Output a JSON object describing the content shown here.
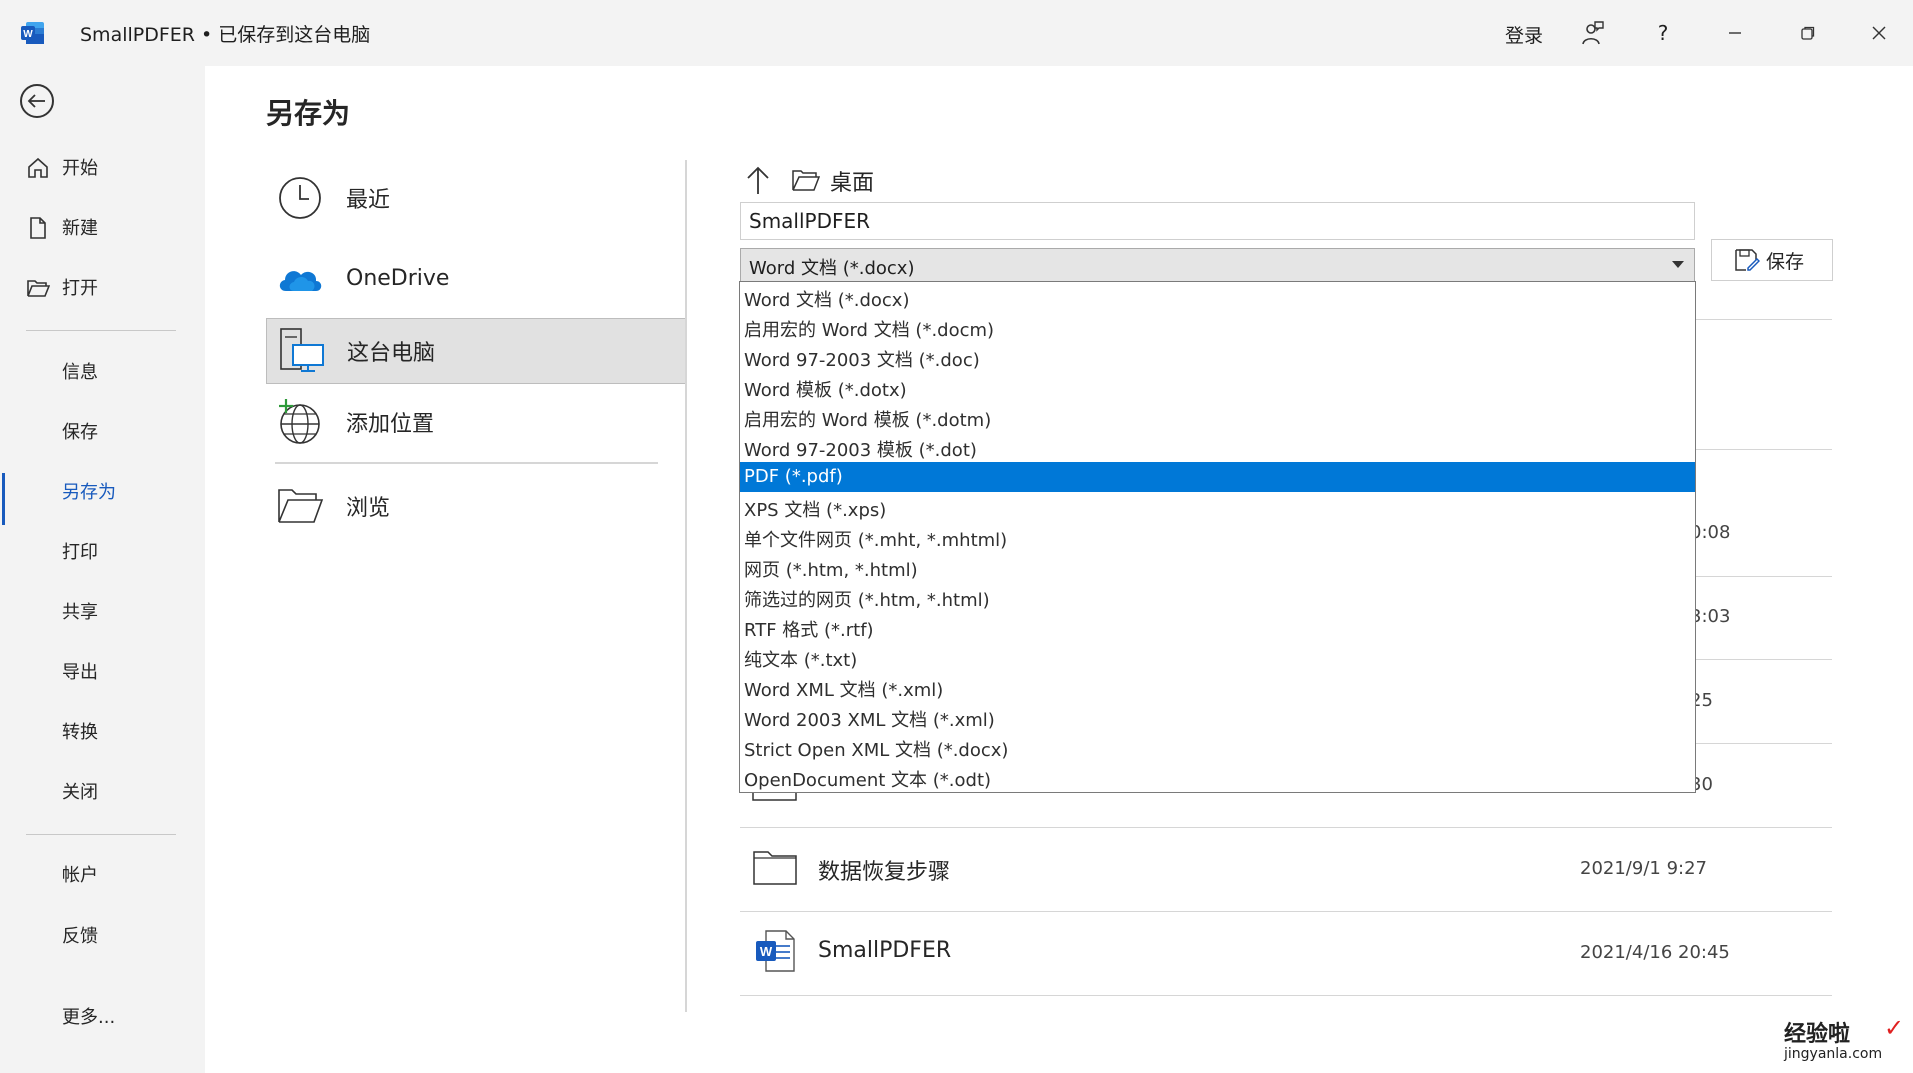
{
  "titlebar": {
    "title": "SmallPDFER • 已保存到这台电脑",
    "login": "登录",
    "help": "?"
  },
  "nav": {
    "items": [
      {
        "label": "开始",
        "icon": "home-icon"
      },
      {
        "label": "新建",
        "icon": "new-document-icon"
      },
      {
        "label": "打开",
        "icon": "open-folder-icon"
      },
      {
        "label": "信息"
      },
      {
        "label": "保存"
      },
      {
        "label": "另存为",
        "active": true
      },
      {
        "label": "打印"
      },
      {
        "label": "共享"
      },
      {
        "label": "导出"
      },
      {
        "label": "转换"
      },
      {
        "label": "关闭"
      },
      {
        "label": "帐户"
      },
      {
        "label": "反馈"
      },
      {
        "label": "更多..."
      }
    ]
  },
  "page": {
    "title": "另存为"
  },
  "locations": [
    {
      "label": "最近",
      "icon": "clock-icon"
    },
    {
      "label": "OneDrive",
      "icon": "onedrive-cloud-icon"
    },
    {
      "label": "这台电脑",
      "icon": "this-pc-icon",
      "selected": true
    },
    {
      "label": "添加位置",
      "icon": "add-location-globe-icon"
    },
    {
      "label": "浏览",
      "icon": "browse-folder-icon"
    }
  ],
  "save_panel": {
    "current_folder": "桌面",
    "filename_value": "SmallPDFER",
    "filetype_selected": "Word 文档 (*.docx)",
    "save_button": "保存"
  },
  "file_types": [
    "Word 文档 (*.docx)",
    "启用宏的 Word 文档 (*.docm)",
    "Word 97-2003 文档 (*.doc)",
    "Word 模板 (*.dotx)",
    "启用宏的 Word 模板 (*.dotm)",
    "Word 97-2003 模板 (*.dot)",
    "PDF (*.pdf)",
    "XPS 文档 (*.xps)",
    "单个文件网页 (*.mht, *.mhtml)",
    "网页 (*.htm, *.html)",
    "筛选过的网页 (*.htm, *.html)",
    "RTF 格式 (*.rtf)",
    "纯文本 (*.txt)",
    "Word XML 文档 (*.xml)",
    "Word 2003 XML 文档 (*.xml)",
    "Strict Open XML 文档 (*.docx)",
    "OpenDocument 文本 (*.odt)"
  ],
  "file_types_highlighted_index": 6,
  "files": [
    {
      "name": "数据恢复步骤",
      "date": "2021/9/1 9:27",
      "icon": "folder-icon"
    },
    {
      "name": "SmallPDFER",
      "date": "2021/4/16 20:45",
      "icon": "word-document-icon"
    }
  ],
  "partial_dates": [
    "0:08",
    "3:03",
    "25",
    "30"
  ],
  "watermark": {
    "text": "经验啦",
    "url": "jingyanla.com"
  },
  "colors": {
    "accent": "#185abd",
    "highlight": "#0078d7"
  }
}
